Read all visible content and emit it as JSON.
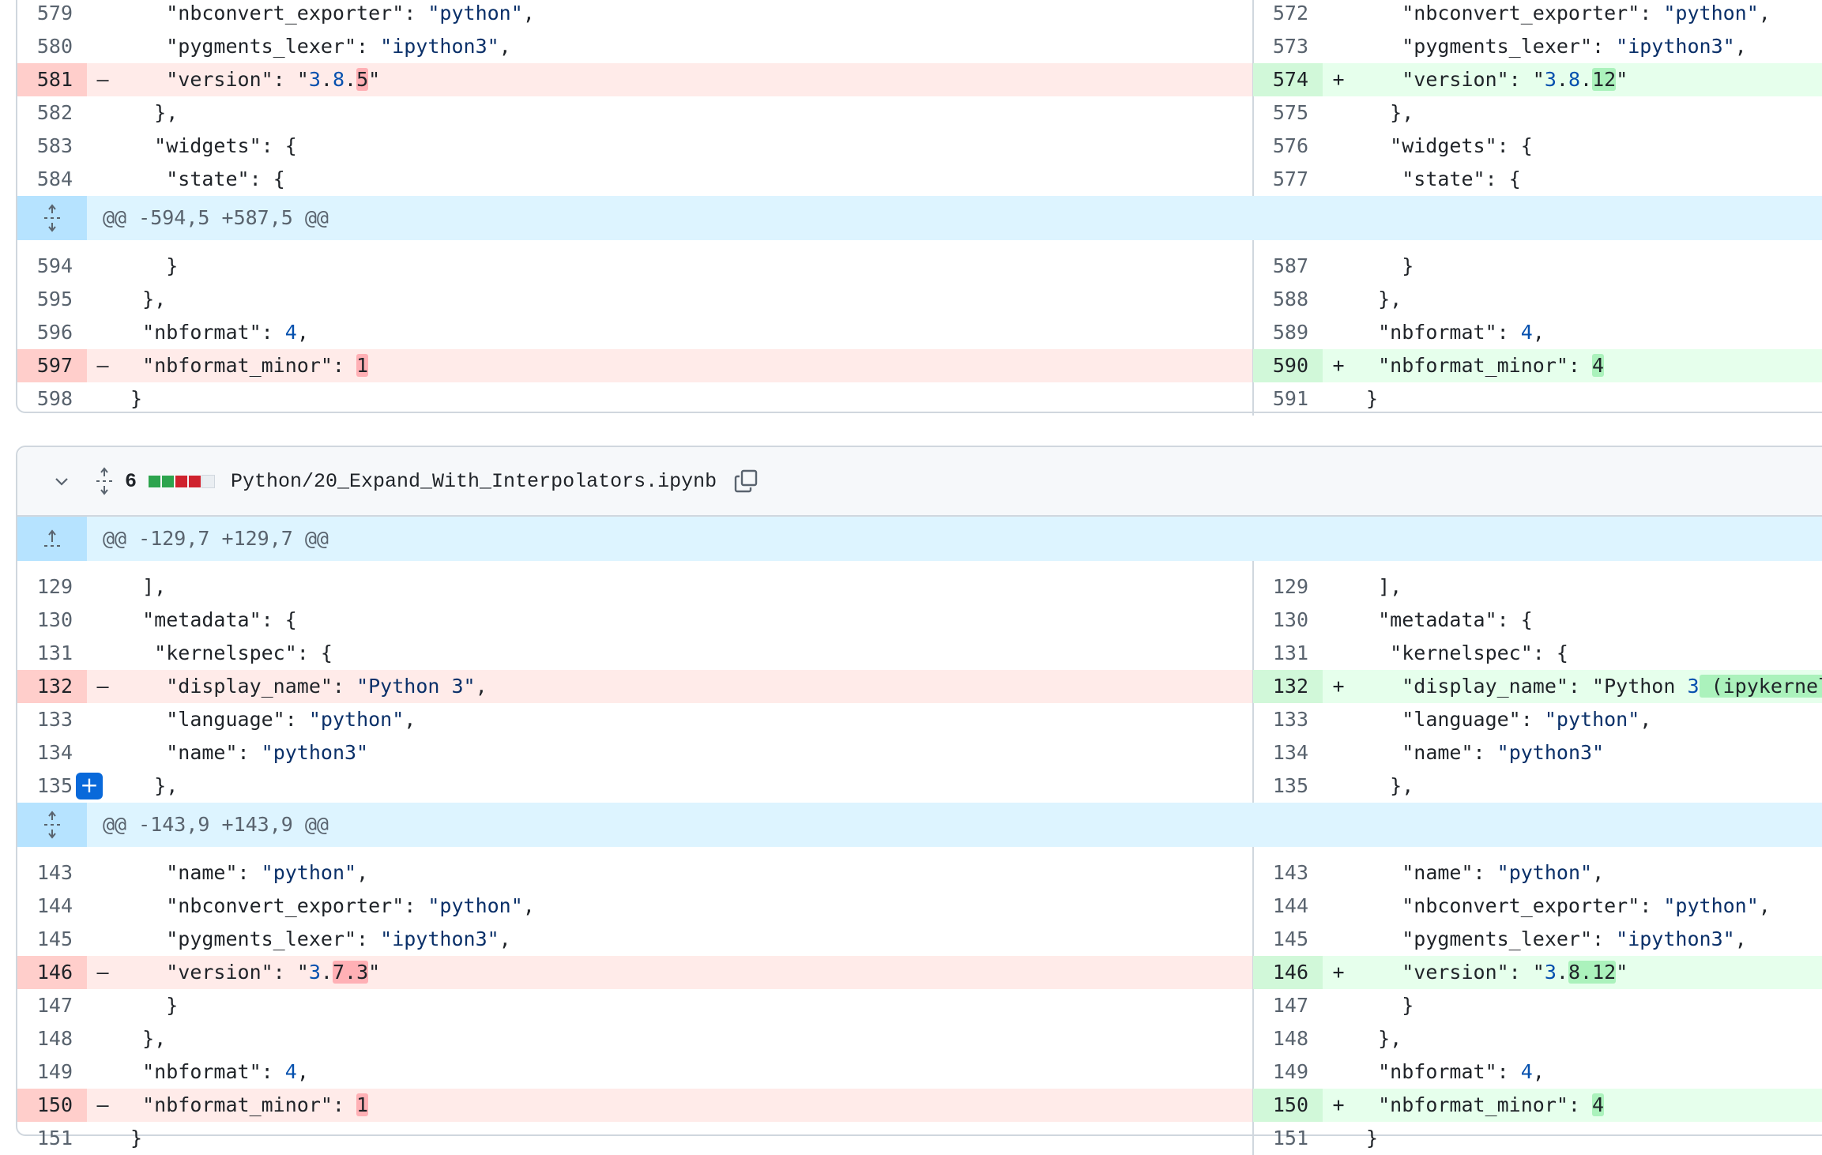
{
  "colors": {
    "del_row_bg": "#ffebe9",
    "del_num_bg": "#ffcecb",
    "del_word_hl": "#ffb0b5",
    "add_row_bg": "#e6ffec",
    "add_num_bg": "#d1f8d9",
    "add_word_hl": "#abf2bc",
    "hunk_bg": "#ddf4ff",
    "hunk_expand_bg": "#b6e3ff",
    "diffstat_add": "#2da44e",
    "diffstat_del": "#cf222e",
    "diffstat_neutral": "#eaeef2"
  },
  "file1": {
    "rows_a": [
      {
        "type": "ctx",
        "ln_l": "579",
        "ln_r": "572",
        "code_l": "    \"nbconvert_exporter\": \"python\",",
        "code_r": "    \"nbconvert_exporter\": \"python\","
      },
      {
        "type": "ctx",
        "ln_l": "580",
        "ln_r": "573",
        "code_l": "    \"pygments_lexer\": \"ipython3\",",
        "code_r": "    \"pygments_lexer\": \"ipython3\","
      },
      {
        "type": "chg",
        "ln_l": "581",
        "ln_r": "574",
        "marker_l": "–",
        "marker_r": "+",
        "l_pre": "    \"version\": \"3.8.",
        "l_hl": "5",
        "l_post": "\"",
        "r_pre": "    \"version\": \"3.8.",
        "r_hl": "12",
        "r_post": "\""
      },
      {
        "type": "ctx",
        "ln_l": "582",
        "ln_r": "575",
        "code_l": "   },",
        "code_r": "   },"
      },
      {
        "type": "ctx",
        "ln_l": "583",
        "ln_r": "576",
        "code_l": "   \"widgets\": {",
        "code_r": "   \"widgets\": {"
      },
      {
        "type": "ctx",
        "ln_l": "584",
        "ln_r": "577",
        "code_l": "    \"state\": {",
        "code_r": "    \"state\": {"
      }
    ],
    "hunk": "@@ -594,5 +587,5 @@",
    "rows_b": [
      {
        "type": "ctx",
        "ln_l": "594",
        "ln_r": "587",
        "code_l": "    }",
        "code_r": "    }"
      },
      {
        "type": "ctx",
        "ln_l": "595",
        "ln_r": "588",
        "code_l": "  },",
        "code_r": "  },"
      },
      {
        "type": "ctx",
        "ln_l": "596",
        "ln_r": "589",
        "code_l": "  \"nbformat\": 4,",
        "code_r": "  \"nbformat\": 4,"
      },
      {
        "type": "chg",
        "ln_l": "597",
        "ln_r": "590",
        "marker_l": "–",
        "marker_r": "+",
        "l_pre": "  \"nbformat_minor\": ",
        "l_hl": "1",
        "l_post": "",
        "r_pre": "  \"nbformat_minor\": ",
        "r_hl": "4",
        "r_post": ""
      },
      {
        "type": "ctx",
        "ln_l": "598",
        "ln_r": "591",
        "code_l": " }",
        "code_r": " }"
      }
    ]
  },
  "file2": {
    "changes_count": "6",
    "diffstat": [
      "add",
      "add",
      "del",
      "del",
      "neutral"
    ],
    "filename": "Python/20_Expand_With_Interpolators.ipynb",
    "hunk1": "@@ -129,7 +129,7 @@",
    "rows_a": [
      {
        "type": "ctx",
        "ln_l": "129",
        "ln_r": "129",
        "code_l": "  ],",
        "code_r": "  ],"
      },
      {
        "type": "ctx",
        "ln_l": "130",
        "ln_r": "130",
        "code_l": "  \"metadata\": {",
        "code_r": "  \"metadata\": {"
      },
      {
        "type": "ctx",
        "ln_l": "131",
        "ln_r": "131",
        "code_l": "   \"kernelspec\": {",
        "code_r": "   \"kernelspec\": {"
      },
      {
        "type": "chg",
        "ln_l": "132",
        "ln_r": "132",
        "marker_l": "–",
        "marker_r": "+",
        "l_pre": "    \"display_name\": \"Python 3\",",
        "l_hl": "",
        "l_post": "",
        "r_pre": "    \"display_name\": \"Python 3",
        "r_hl": " (ipykernel)",
        "r_post": "\","
      },
      {
        "type": "ctx",
        "ln_l": "133",
        "ln_r": "133",
        "code_l": "    \"language\": \"python\",",
        "code_r": "    \"language\": \"python\","
      },
      {
        "type": "ctx",
        "ln_l": "134",
        "ln_r": "134",
        "code_l": "    \"name\": \"python3\"",
        "code_r": "    \"name\": \"python3\""
      },
      {
        "type": "ctx",
        "ln_l": "135",
        "ln_r": "135",
        "code_l": "   },",
        "code_r": "   },",
        "comment_button": "+"
      }
    ],
    "hunk2": "@@ -143,9 +143,9 @@",
    "rows_b": [
      {
        "type": "ctx",
        "ln_l": "143",
        "ln_r": "143",
        "code_l": "    \"name\": \"python\",",
        "code_r": "    \"name\": \"python\","
      },
      {
        "type": "ctx",
        "ln_l": "144",
        "ln_r": "144",
        "code_l": "    \"nbconvert_exporter\": \"python\",",
        "code_r": "    \"nbconvert_exporter\": \"python\","
      },
      {
        "type": "ctx",
        "ln_l": "145",
        "ln_r": "145",
        "code_l": "    \"pygments_lexer\": \"ipython3\",",
        "code_r": "    \"pygments_lexer\": \"ipython3\","
      },
      {
        "type": "chg",
        "ln_l": "146",
        "ln_r": "146",
        "marker_l": "–",
        "marker_r": "+",
        "l_pre": "    \"version\": \"3.",
        "l_hl": "7.3",
        "l_post": "\"",
        "r_pre": "    \"version\": \"3.",
        "r_hl": "8.12",
        "r_post": "\""
      },
      {
        "type": "ctx",
        "ln_l": "147",
        "ln_r": "147",
        "code_l": "    }",
        "code_r": "    }"
      },
      {
        "type": "ctx",
        "ln_l": "148",
        "ln_r": "148",
        "code_l": "  },",
        "code_r": "  },"
      },
      {
        "type": "ctx",
        "ln_l": "149",
        "ln_r": "149",
        "code_l": "  \"nbformat\": 4,",
        "code_r": "  \"nbformat\": 4,"
      },
      {
        "type": "chg",
        "ln_l": "150",
        "ln_r": "150",
        "marker_l": "–",
        "marker_r": "+",
        "l_pre": "  \"nbformat_minor\": ",
        "l_hl": "1",
        "l_post": "",
        "r_pre": "  \"nbformat_minor\": ",
        "r_hl": "4",
        "r_post": ""
      },
      {
        "type": "ctx",
        "ln_l": "151",
        "ln_r": "151",
        "code_l": " }",
        "code_r": " }"
      }
    ]
  }
}
